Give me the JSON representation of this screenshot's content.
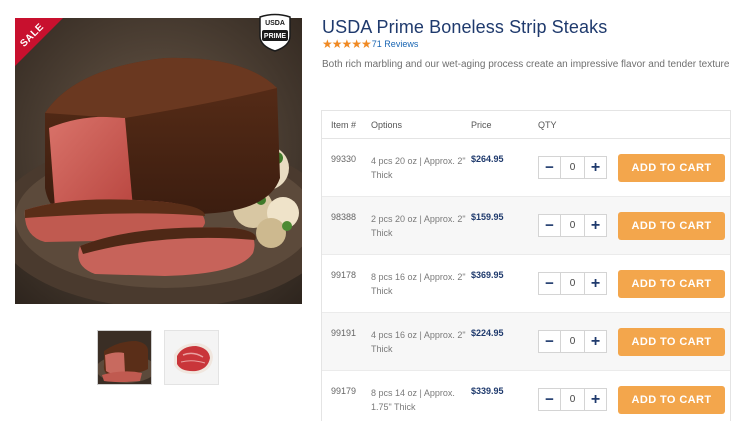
{
  "product": {
    "title": "USDA Prime Boneless Strip Steaks",
    "stars": "★★★★★",
    "reviews": "71 Reviews",
    "description": "Both rich marbling and our wet-aging process create an impressive flavor and tender texture",
    "sale_badge": "SALE",
    "usda_line1": "USDA",
    "usda_line2": "PRIME"
  },
  "colors": {
    "title": "#1f3a6d",
    "accent_orange": "#f3a64c",
    "star": "#f08a24",
    "sale": "#c8102e",
    "link": "#1a66b3"
  },
  "table": {
    "headers": {
      "item": "Item #",
      "options": "Options",
      "price": "Price",
      "qty": "QTY"
    },
    "cart_label": "ADD TO CART",
    "minus": "−",
    "plus": "+",
    "rows": [
      {
        "item": "99330",
        "options": "4 pcs 20 oz | Approx. 2\" Thick",
        "price": "$264.95",
        "qty": "0"
      },
      {
        "item": "98388",
        "options": "2 pcs 20 oz | Approx. 2\" Thick",
        "price": "$159.95",
        "qty": "0"
      },
      {
        "item": "99178",
        "options": "8 pcs 16 oz | Approx. 2\" Thick",
        "price": "$369.95",
        "qty": "0"
      },
      {
        "item": "99191",
        "options": "4 pcs 16 oz | Approx. 2\" Thick",
        "price": "$224.95",
        "qty": "0"
      },
      {
        "item": "99179",
        "options": "8 pcs 14 oz | Approx. 1.75\" Thick",
        "price": "$339.95",
        "qty": "0"
      }
    ]
  }
}
